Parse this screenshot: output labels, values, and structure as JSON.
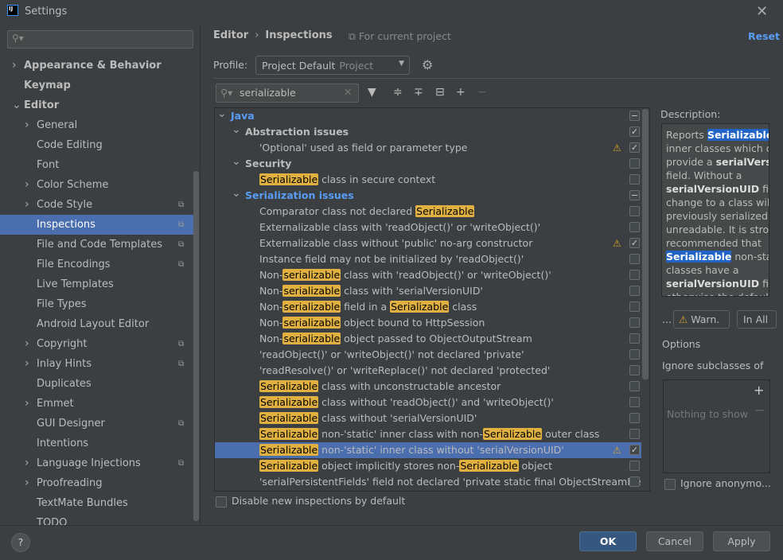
{
  "window": {
    "title": "Settings",
    "logo": "IJ",
    "close_icon": "close-icon"
  },
  "sidebar": {
    "search_placeholder": "",
    "items": [
      {
        "label": "Appearance & Behavior",
        "level": 0,
        "chevron": "right",
        "bold": true
      },
      {
        "label": "Keymap",
        "level": 0,
        "bold": true
      },
      {
        "label": "Editor",
        "level": 0,
        "chevron": "down",
        "bold": true
      },
      {
        "label": "General",
        "level": 1,
        "chevron": "right"
      },
      {
        "label": "Code Editing",
        "level": 1
      },
      {
        "label": "Font",
        "level": 1
      },
      {
        "label": "Color Scheme",
        "level": 1,
        "chevron": "right"
      },
      {
        "label": "Code Style",
        "level": 1,
        "chevron": "right",
        "copy": true
      },
      {
        "label": "Inspections",
        "level": 1,
        "copy": true,
        "selected": true
      },
      {
        "label": "File and Code Templates",
        "level": 1,
        "copy": true
      },
      {
        "label": "File Encodings",
        "level": 1,
        "copy": true
      },
      {
        "label": "Live Templates",
        "level": 1
      },
      {
        "label": "File Types",
        "level": 1
      },
      {
        "label": "Android Layout Editor",
        "level": 1
      },
      {
        "label": "Copyright",
        "level": 1,
        "chevron": "right",
        "copy": true
      },
      {
        "label": "Inlay Hints",
        "level": 1,
        "chevron": "right",
        "copy": true
      },
      {
        "label": "Duplicates",
        "level": 1
      },
      {
        "label": "Emmet",
        "level": 1,
        "chevron": "right"
      },
      {
        "label": "GUI Designer",
        "level": 1,
        "copy": true
      },
      {
        "label": "Intentions",
        "level": 1
      },
      {
        "label": "Language Injections",
        "level": 1,
        "chevron": "right",
        "copy": true
      },
      {
        "label": "Proofreading",
        "level": 1,
        "chevron": "right"
      },
      {
        "label": "TextMate Bundles",
        "level": 1
      },
      {
        "label": "TODO",
        "level": 1
      }
    ]
  },
  "header": {
    "breadcrumb": [
      "Editor",
      "Inspections"
    ],
    "scope_note": "For current project",
    "reset": "Reset"
  },
  "profile": {
    "label": "Profile:",
    "value": "Project Default",
    "sub": "Project"
  },
  "filter": {
    "value": "serializable",
    "placeholder": ""
  },
  "tree": [
    {
      "level": 0,
      "chevron": "down",
      "bold": true,
      "blue": true,
      "state": "mixed",
      "segs": [
        [
          "Java",
          0
        ]
      ]
    },
    {
      "level": 1,
      "chevron": "down",
      "bold": true,
      "state": "checked",
      "segs": [
        [
          "Abstraction issues",
          0
        ]
      ]
    },
    {
      "level": 2,
      "warn": true,
      "state": "checked",
      "segs": [
        [
          "'Optional' used as field or parameter type",
          0
        ]
      ]
    },
    {
      "level": 1,
      "chevron": "down",
      "bold": true,
      "state": "unchecked",
      "segs": [
        [
          "Security",
          0
        ]
      ]
    },
    {
      "level": 2,
      "state": "unchecked",
      "segs": [
        [
          "Serializable",
          1
        ],
        [
          " class in secure context",
          0
        ]
      ]
    },
    {
      "level": 1,
      "chevron": "down",
      "bold": true,
      "blue": true,
      "state": "mixed",
      "segs": [
        [
          "Serialization issues",
          0
        ]
      ]
    },
    {
      "level": 2,
      "state": "unchecked",
      "segs": [
        [
          "Comparator class not declared ",
          0
        ],
        [
          "Serializable",
          1
        ]
      ]
    },
    {
      "level": 2,
      "state": "unchecked",
      "segs": [
        [
          "Externalizable class with 'readObject()' or 'writeObject()'",
          0
        ]
      ]
    },
    {
      "level": 2,
      "warn": true,
      "state": "checked",
      "segs": [
        [
          "Externalizable class without 'public' no-arg constructor",
          0
        ]
      ]
    },
    {
      "level": 2,
      "state": "unchecked",
      "segs": [
        [
          "Instance field may not be initialized by 'readObject()'",
          0
        ]
      ]
    },
    {
      "level": 2,
      "state": "unchecked",
      "segs": [
        [
          "Non-",
          0
        ],
        [
          "serializable",
          1
        ],
        [
          " class with 'readObject()' or 'writeObject()'",
          0
        ]
      ]
    },
    {
      "level": 2,
      "state": "unchecked",
      "segs": [
        [
          "Non-",
          0
        ],
        [
          "serializable",
          1
        ],
        [
          " class with 'serialVersionUID'",
          0
        ]
      ]
    },
    {
      "level": 2,
      "state": "unchecked",
      "segs": [
        [
          "Non-",
          0
        ],
        [
          "serializable",
          1
        ],
        [
          " field in a ",
          0
        ],
        [
          "Serializable",
          1
        ],
        [
          " class",
          0
        ]
      ]
    },
    {
      "level": 2,
      "state": "unchecked",
      "segs": [
        [
          "Non-",
          0
        ],
        [
          "serializable",
          1
        ],
        [
          " object bound to HttpSession",
          0
        ]
      ]
    },
    {
      "level": 2,
      "state": "unchecked",
      "segs": [
        [
          "Non-",
          0
        ],
        [
          "serializable",
          1
        ],
        [
          " object passed to ObjectOutputStream",
          0
        ]
      ]
    },
    {
      "level": 2,
      "state": "unchecked",
      "segs": [
        [
          "'readObject()' or 'writeObject()' not declared 'private'",
          0
        ]
      ]
    },
    {
      "level": 2,
      "state": "unchecked",
      "segs": [
        [
          "'readResolve()' or 'writeReplace()' not declared 'protected'",
          0
        ]
      ]
    },
    {
      "level": 2,
      "state": "unchecked",
      "segs": [
        [
          "Serializable",
          1
        ],
        [
          " class with unconstructable ancestor",
          0
        ]
      ]
    },
    {
      "level": 2,
      "state": "unchecked",
      "segs": [
        [
          "Serializable",
          1
        ],
        [
          " class without 'readObject()' and 'writeObject()'",
          0
        ]
      ]
    },
    {
      "level": 2,
      "state": "unchecked",
      "segs": [
        [
          "Serializable",
          1
        ],
        [
          " class without 'serialVersionUID'",
          0
        ]
      ]
    },
    {
      "level": 2,
      "state": "unchecked",
      "segs": [
        [
          "Serializable",
          1
        ],
        [
          " non-'static' inner class with non-",
          0
        ],
        [
          "Serializable",
          1
        ],
        [
          " outer class",
          0
        ]
      ]
    },
    {
      "level": 2,
      "warn": true,
      "state": "checked",
      "selected": true,
      "segs": [
        [
          "Serializable",
          1
        ],
        [
          " non-'static' inner class without 'serialVersionUID'",
          0
        ]
      ]
    },
    {
      "level": 2,
      "state": "unchecked",
      "segs": [
        [
          "Serializable",
          1
        ],
        [
          " object implicitly stores non-",
          0
        ],
        [
          "Serializable",
          1
        ],
        [
          " object",
          0
        ]
      ]
    },
    {
      "level": 2,
      "state": "unchecked",
      "segs": [
        [
          "'serialPersistentFields' field not declared 'private static final ObjectStreamFie",
          0
        ]
      ]
    }
  ],
  "disable_new": "Disable new inspections by default",
  "description": {
    "label": "Description:",
    "lines": [
      [
        [
          "Reports ",
          0
        ],
        [
          "Serializable",
          2
        ],
        [
          " n",
          0
        ]
      ],
      [
        [
          "inner classes which do",
          0
        ]
      ],
      [
        [
          "provide a ",
          0
        ],
        [
          "serialVersio",
          1
        ]
      ],
      [
        [
          "field. Without a",
          0
        ]
      ],
      [
        [
          "serialVersionUID",
          1
        ],
        [
          " field",
          0
        ]
      ],
      [
        [
          "change to a class will r",
          0
        ]
      ],
      [
        [
          "previously serialized v",
          0
        ]
      ],
      [
        [
          "unreadable. It is strong",
          0
        ]
      ],
      [
        [
          "recommended that",
          0
        ]
      ],
      [
        [
          "Serializable",
          2
        ],
        [
          " non-static",
          0
        ]
      ],
      [
        [
          "classes have a",
          0
        ]
      ],
      [
        [
          "serialVersionUID",
          1
        ],
        [
          " field",
          0
        ]
      ],
      [
        [
          "otherwise the default",
          0
        ]
      ]
    ]
  },
  "severity": {
    "dots": "...",
    "value": "Warn.",
    "scope": "In All"
  },
  "options": {
    "title": "Options",
    "ignore_subclasses": "Ignore subclasses of",
    "empty": "Nothing to show",
    "add": "+",
    "remove": "−",
    "ignore_anonymous": "Ignore anonymo..."
  },
  "footer": {
    "help": "?",
    "ok": "OK",
    "cancel": "Cancel",
    "apply": "Apply"
  },
  "colors": {
    "selection": "#4b6eaf",
    "match_highlight": "#e0b040",
    "link": "#589df6",
    "warning": "#d9a32b",
    "ok_button": "#365880"
  }
}
